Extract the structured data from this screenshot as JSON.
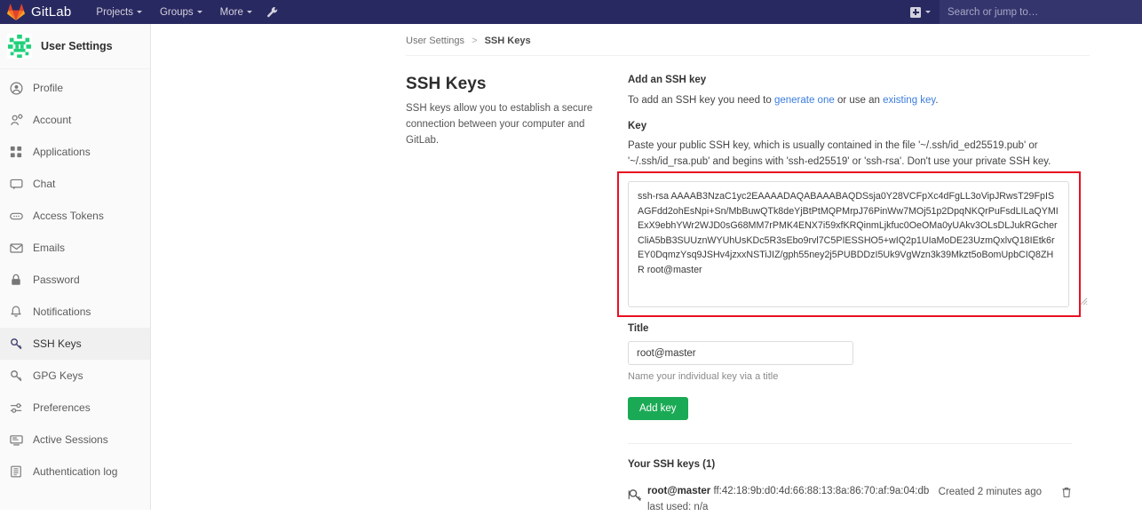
{
  "navbar": {
    "brand": "GitLab",
    "logo_icon": "gitlab-tanuki-icon",
    "links": [
      {
        "label": "Projects",
        "icon": "chevron-down-icon"
      },
      {
        "label": "Groups",
        "icon": "chevron-down-icon"
      },
      {
        "label": "More",
        "icon": "chevron-down-icon"
      }
    ],
    "wrench_icon": "wrench-icon",
    "plus_icon": "plus-square-icon",
    "plus_caret_icon": "chevron-down-icon",
    "search_placeholder": "Search or jump to…"
  },
  "sidebar": {
    "avatar_icon": "user-identicon-avatar",
    "title": "User Settings",
    "items": [
      {
        "label": "Profile",
        "icon": "user-circle-icon",
        "active": false
      },
      {
        "label": "Account",
        "icon": "account-gear-icon",
        "active": false
      },
      {
        "label": "Applications",
        "icon": "applications-grid-icon",
        "active": false
      },
      {
        "label": "Chat",
        "icon": "chat-bubble-icon",
        "active": false
      },
      {
        "label": "Access Tokens",
        "icon": "token-pill-icon",
        "active": false
      },
      {
        "label": "Emails",
        "icon": "envelope-icon",
        "active": false
      },
      {
        "label": "Password",
        "icon": "lock-icon",
        "active": false
      },
      {
        "label": "Notifications",
        "icon": "bell-icon",
        "active": false
      },
      {
        "label": "SSH Keys",
        "icon": "key-icon",
        "active": true
      },
      {
        "label": "GPG Keys",
        "icon": "key-icon",
        "active": false
      },
      {
        "label": "Preferences",
        "icon": "sliders-icon",
        "active": false
      },
      {
        "label": "Active Sessions",
        "icon": "monitor-icon",
        "active": false
      },
      {
        "label": "Authentication log",
        "icon": "log-book-icon",
        "active": false
      }
    ]
  },
  "breadcrumb": {
    "parent": "User Settings",
    "separator": ">",
    "current": "SSH Keys"
  },
  "page": {
    "title": "SSH Keys",
    "description": "SSH keys allow you to establish a secure connection between your computer and GitLab."
  },
  "add_key": {
    "heading": "Add an SSH key",
    "intro_pre": "To add an SSH key you need to ",
    "link_generate": "generate one",
    "intro_mid": " or use an ",
    "link_existing": "existing key",
    "intro_post": ".",
    "key_label": "Key",
    "key_help": "Paste your public SSH key, which is usually contained in the file '~/.ssh/id_ed25519.pub' or '~/.ssh/id_rsa.pub' and begins with 'ssh-ed25519' or 'ssh-rsa'. Don't use your private SSH key.",
    "key_value": "ssh-rsa AAAAB3NzaC1yc2EAAAADAQABAAABAQDSsja0Y28VCFpXc4dFgLL3oVipJRwsT29FpISAGFdd2ohEsNpi+Sn/MbBuwQTk8deYjBtPtMQPMrpJ76PinWw7MOj51p2DpqNKQrPuFsdLILaQYMIExX9ebhYWr2WJD0sG68MM7rPMK4ENX7i59xfKRQinmLjkfuc0OeOMa0yUAkv3OLsDLJukRGcherCliA5bB3SUUznWYUhUsKDc5R3sEbo9rvl7C5PIESSHO5+wIQ2p1UIaMoDE23UzmQxlvQ18IEtk6rEY0DqmzYsq9JSHv4jzxxNSTiJIZ/gph55ney2j5PUBDDzI5Uk9VgWzn3k39Mkzt5oBomUpbCIQ8ZHR root@master",
    "title_label": "Title",
    "title_value": "root@master",
    "title_hint": "Name your individual key via a title",
    "submit_label": "Add key",
    "submit_color": "#1aaa55",
    "annotation_color": "#e81123",
    "resize_handle_icon": "resize-grip-icon"
  },
  "key_list": {
    "heading": "Your SSH keys (1)",
    "rows": [
      {
        "icon": "key-icon",
        "name": "root@master",
        "fingerprint": "ff:42:18:9b:d0:4d:66:88:13:8a:86:70:af:9a:04:db",
        "last_used": "last used: n/a",
        "created": "Created 2 minutes ago",
        "delete_icon": "trash-icon"
      }
    ]
  }
}
